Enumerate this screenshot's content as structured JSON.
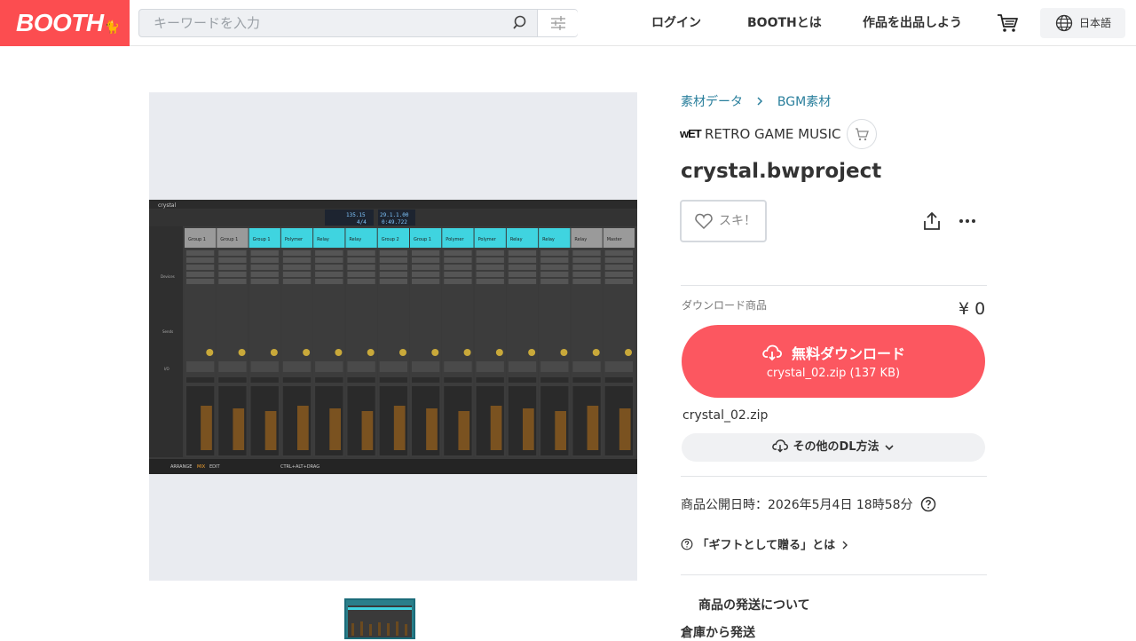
{
  "header": {
    "logo_text": "BOOTH",
    "search_placeholder": "キーワードを入力",
    "nav": [
      "ログイン",
      "BOOTHとは",
      "作品を出品しよう"
    ],
    "lang_label": "日本語",
    "brand_color": "#fc4d50"
  },
  "icons": {
    "search": "search-icon",
    "filter": "sliders-icon",
    "cart": "cart-icon",
    "lang": "globe-icon",
    "like": "heart-icon",
    "share": "share-icon",
    "more": "more-dots-icon",
    "download": "cloud-download-icon",
    "help": "question-circle-icon"
  },
  "breadcrumb": {
    "category": "素材データ",
    "subcategory": "BGM素材"
  },
  "shop": {
    "logo_text": "wET",
    "name": "RETRO GAME MUSIC"
  },
  "product": {
    "title": "crystal.bwproject",
    "like_label": "スキ！",
    "download_section_label": "ダウンロード商品",
    "price": "¥ 0",
    "download_button_label": "無料ダウンロード",
    "download_file_info": "crystal_02.zip (137 KB)",
    "file_name": "crystal_02.zip",
    "other_dl_label": "その他のDL方法",
    "published": "商品公開日時：2026年5月4日 18時58分",
    "gift_label": "「ギフトとして贈る」とは",
    "shipping_title": "商品の発送について",
    "shipping_sub": "倉庫から発送",
    "accent_color": "#fc5760"
  },
  "screenshot": {
    "tab_title": "crystal",
    "tempo": "135.15",
    "signature": "4/4",
    "position": "29.1.1.00",
    "time": "0:49.722",
    "bottom_tabs": [
      "ARRANGE",
      "MIX",
      "EDIT"
    ],
    "hint": "CTRL+ALT+DRAG",
    "tracks": [
      "Group 1",
      "Group 1",
      "Group 1",
      "Polymer",
      "Relay",
      "Relay",
      "Group 2",
      "Group 1",
      "Polymer",
      "Polymer",
      "Relay",
      "Relay",
      "Relay",
      "Master"
    ],
    "track_active": [
      false,
      false,
      true,
      true,
      true,
      true,
      true,
      true,
      true,
      true,
      true,
      true,
      false,
      false
    ],
    "row_labels": [
      "Devices",
      "Sends",
      "I/O"
    ],
    "teal_color": "#3fd4e0"
  }
}
